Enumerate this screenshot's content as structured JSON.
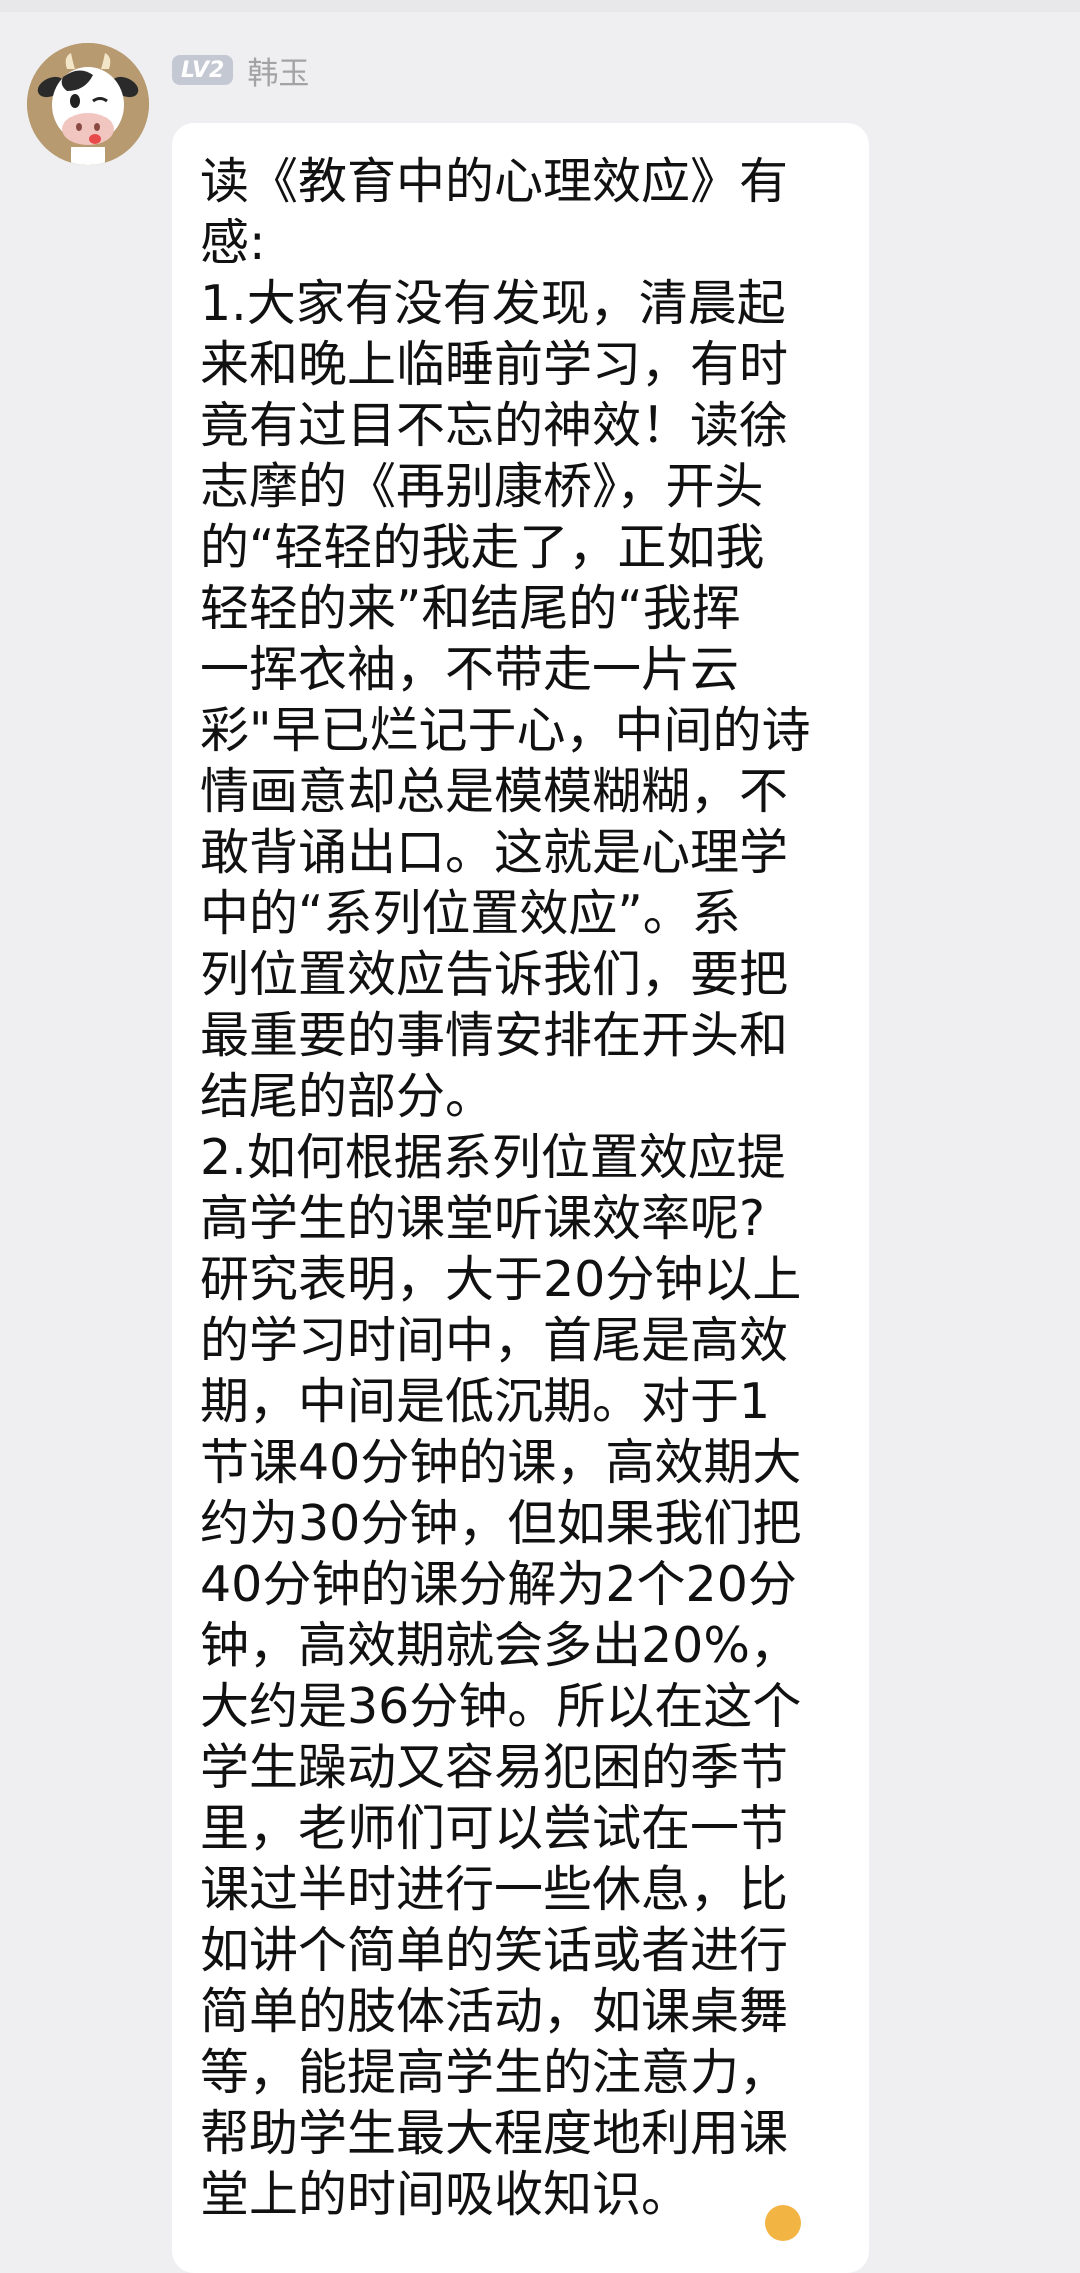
{
  "sender": {
    "level_badge": "LV2",
    "name": "韩玉",
    "avatar_icon": "cow-cartoon-avatar-icon"
  },
  "message": {
    "text": "读《教育中的心理效应》有\n感:\n1.大家有没有发现，清晨起\n来和晚上临睡前学习，有时\n竟有过目不忘的神效！读徐\n志摩的《再别康桥》，开头\n的“轻轻的我走了，正如我\n轻轻的来”和结尾的“我挥\n一挥衣袖，不带走一片云\n彩\"早已烂记于心，中间的诗\n情画意却总是模模糊糊，不\n敢背诵出口。这就是心理学\n中的“系列位置效应”。系\n列位置效应告诉我们，要把\n最重要的事情安排在开头和\n结尾的部分。\n2.如何根据系列位置效应提\n高学生的课堂听课效率呢?\n研究表明，大于20分钟以上\n的学习时间中，首尾是高效\n期，中间是低沉期。对于1\n节课40分钟的课，高效期大\n约为30分钟，但如果我们把\n40分钟的课分解为2个20分\n钟，高效期就会多出20%，\n大约是36分钟。所以在这个\n学生躁动又容易犯困的季节\n里，老师们可以尝试在一节\n课过半时进行一些休息，比\n如讲个简单的笑话或者进行\n简单的肢体活动，如课桌舞\n等，能提高学生的注意力，\n帮助学生最大程度地利用课\n堂上的时间吸收知识。"
  },
  "colors": {
    "background": "#efeff1",
    "bubble": "#ffffff",
    "text": "#111111",
    "name": "#a3a3a6",
    "badge": "#c3c8d3"
  }
}
